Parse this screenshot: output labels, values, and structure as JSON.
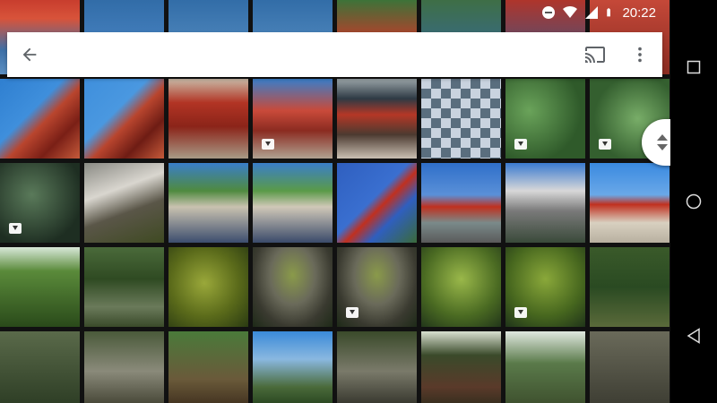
{
  "status_bar": {
    "time": "20:22",
    "icons": [
      "do-not-disturb-icon",
      "wifi-icon",
      "cell-signal-icon",
      "battery-icon"
    ]
  },
  "toolbar": {
    "back_icon": "arrow-left-icon",
    "cast_icon": "cast-icon",
    "menu_icon": "more-vert-icon"
  },
  "photos": [
    {
      "name": "photo-shrine-gate-top-1",
      "video": false,
      "bg": "linear-gradient(180deg,#c3372a 0%,#d8533a 30%,#3d70a8 70%,#5b8fc2 100%)"
    },
    {
      "name": "photo-shrine-gate-top-2",
      "video": false,
      "bg": "linear-gradient(180deg,#2f6aa5 0%,#447fbd 60%,#5e95c8 100%)"
    },
    {
      "name": "photo-sky-1",
      "video": false,
      "bg": "linear-gradient(180deg,#2f6aa5,#5e95c8)"
    },
    {
      "name": "photo-sky-2",
      "video": false,
      "bg": "linear-gradient(180deg,#2f6aa5,#5e95c8)"
    },
    {
      "name": "photo-shrine-gate-top-3",
      "video": false,
      "bg": "linear-gradient(180deg,#2c7a3a,#c23a2a 60%,#d14a3a)"
    },
    {
      "name": "photo-trees-sky",
      "video": false,
      "bg": "linear-gradient(180deg,#3f6f3f,#3468a5)"
    },
    {
      "name": "photo-red-building-top",
      "video": false,
      "bg": "linear-gradient(180deg,#b83224,#2f5a8f)"
    },
    {
      "name": "photo-red-building-edge",
      "video": false,
      "bg": "linear-gradient(180deg,#c94a3a,#8a2c22)"
    },
    {
      "name": "photo-shrine-roof-1",
      "video": false,
      "bg": "linear-gradient(135deg,#2f7fd0 0%,#3f8fdc 40%,#b9452e 55%,#7a1f16 75%,#c55a3a 100%)"
    },
    {
      "name": "photo-shrine-roof-2",
      "video": false,
      "bg": "linear-gradient(135deg,#3f8fdc 0%,#4a98e0 40%,#b9452e 55%,#6e1c14 75%,#c55a3a 100%)"
    },
    {
      "name": "photo-shrine-corridor-1",
      "video": false,
      "bg": "linear-gradient(180deg,#c8b9a6 0%,#b23424 30%,#8b2419 60%,#a89a86 100%)"
    },
    {
      "name": "photo-shrine-corridor-2",
      "video": true,
      "bg": "linear-gradient(180deg,#3a7ec9 0%,#c94a3a 40%,#8b2b21 65%,#b0a291 100%)"
    },
    {
      "name": "photo-shrine-visitors",
      "video": false,
      "bg": "linear-gradient(180deg,#9aa4a8 0%,#2e3a44 25%,#b53726 45%,#4c3a30 70%,#c9bfb2 100%)"
    },
    {
      "name": "photo-pixelated",
      "video": false,
      "bg": "repeating-conic-gradient(#5a6e7e 0% 25%, #c9d3df 0% 50%) 0 0/22px 22px"
    },
    {
      "name": "photo-lotus-pond-1",
      "video": true,
      "bg": "radial-gradient(circle at 30% 40%,#6aa35a,#2f5a2a 70%),#2f5a2a"
    },
    {
      "name": "photo-lotus-pond-2",
      "video": true,
      "bg": "radial-gradient(circle at 60% 50%,#78ad68,#345f2f 70%),#345f2f"
    },
    {
      "name": "photo-pond-water",
      "video": true,
      "bg": "radial-gradient(circle at 40% 40%,#5a7a5a,#1e2e22 75%)"
    },
    {
      "name": "photo-stone-bridge",
      "video": false,
      "bg": "linear-gradient(160deg,#8a8a84 0%,#d9d6cf 35%,#5a5648 60%,#3f4a22 100%)"
    },
    {
      "name": "photo-arched-bridge-1",
      "video": false,
      "bg": "linear-gradient(180deg,#3a7ec9 0%,#4f8a3f 35%,#c9c2b0 55%,#3c4d6e 100%)"
    },
    {
      "name": "photo-arched-bridge-2",
      "video": false,
      "bg": "linear-gradient(180deg,#3a7ec9 0%,#5a9a48 35%,#d0c8b8 55%,#3a4a6a 100%)"
    },
    {
      "name": "photo-red-torii",
      "video": false,
      "bg": "linear-gradient(135deg,#2f5fbf 0%,#3a6fd0 45%,#c0301f 55%,#2f5fbf 70%,#3a6a3a 100%)"
    },
    {
      "name": "photo-torii-street",
      "video": false,
      "bg": "linear-gradient(180deg,#2f6fc9 0%,#5a90d8 40%,#c0301f 55%,#7a8a8a 75%,#5a5a5a 100%)"
    },
    {
      "name": "photo-building-statue",
      "video": false,
      "bg": "linear-gradient(180deg,#3a7ad0 0%,#d8d8d8 35%,#7a7a7a 60%,#3a4a3a 100%)"
    },
    {
      "name": "photo-torii-plaza",
      "video": false,
      "bg": "linear-gradient(180deg,#3a8ae0 0%,#6aa8e8 40%,#c0301f 52%,#d8d0c0 75%,#b8b0a0 100%)"
    },
    {
      "name": "photo-forest-ferns",
      "video": false,
      "bg": "linear-gradient(180deg,#d8e8d8 0%,#5a8a3a 30%,#2a4a1a 100%)"
    },
    {
      "name": "photo-forest-steps",
      "video": false,
      "bg": "linear-gradient(180deg,#4a6a3a 0%,#2f4a22 40%,#6a7a5a 75%,#3a4a2a 100%)"
    },
    {
      "name": "photo-mossy-rock",
      "video": false,
      "bg": "radial-gradient(circle at 45% 45%,#9aa83a,#5a6a1a 55%,#2a3a12 100%)"
    },
    {
      "name": "photo-stone-lantern-1",
      "video": false,
      "bg": "radial-gradient(ellipse at 50% 35%,#8a9a4a 0%,#6a6a5a 40%,#3a3a30 70%,#1e2a18 100%)"
    },
    {
      "name": "photo-stone-lantern-2",
      "video": true,
      "bg": "radial-gradient(ellipse at 50% 35%,#8a9a4a 0%,#6a6a5a 40%,#3a3a30 70%,#1e2a18 100%)"
    },
    {
      "name": "photo-moss-ground-1",
      "video": false,
      "bg": "radial-gradient(circle at 50% 40%,#9ab84a,#4a6a22 60%,#22361a 100%)"
    },
    {
      "name": "photo-moss-ground-2",
      "video": true,
      "bg": "radial-gradient(circle at 50% 40%,#8aa83a,#46661e 60%,#20341a 100%)"
    },
    {
      "name": "photo-forest-path",
      "video": false,
      "bg": "linear-gradient(180deg,#3a5a2a 0%,#2a4a22 50%,#5a6a3a 100%)"
    },
    {
      "name": "photo-forest-slope",
      "video": false,
      "bg": "linear-gradient(180deg,#5a6a4a,#2a3a22)"
    },
    {
      "name": "photo-stone-graves",
      "video": false,
      "bg": "linear-gradient(180deg,#4a5a3a 0%,#8a8a7a 50%,#3a3a2a 100%)"
    },
    {
      "name": "photo-wooden-fence",
      "video": false,
      "bg": "linear-gradient(180deg,#4a7a3a 0%,#6a5a3a 60%,#3a2a1a 100%)"
    },
    {
      "name": "photo-sea-view",
      "video": false,
      "bg": "linear-gradient(180deg,#3a8ad8 0%,#8ab8e0 35%,#4a6a3a 70%,#1e3a18 100%)"
    },
    {
      "name": "photo-stone-stairs",
      "video": false,
      "bg": "linear-gradient(180deg,#3a4a2a 0%,#7a7a6a 50%,#2a2a22 100%)"
    },
    {
      "name": "photo-forest-trunks",
      "video": false,
      "bg": "linear-gradient(180deg,#d8e0d0 0%,#3a4a2a 30%,#5a3a2a 70%,#2a2a1a 100%)"
    },
    {
      "name": "photo-bamboo",
      "video": false,
      "bg": "linear-gradient(180deg,#e0e8e0 0%,#5a7a4a 40%,#3a4a2a 100%)"
    },
    {
      "name": "photo-rocks",
      "video": false,
      "bg": "linear-gradient(180deg,#6a6a5a,#3a3a30)"
    }
  ]
}
